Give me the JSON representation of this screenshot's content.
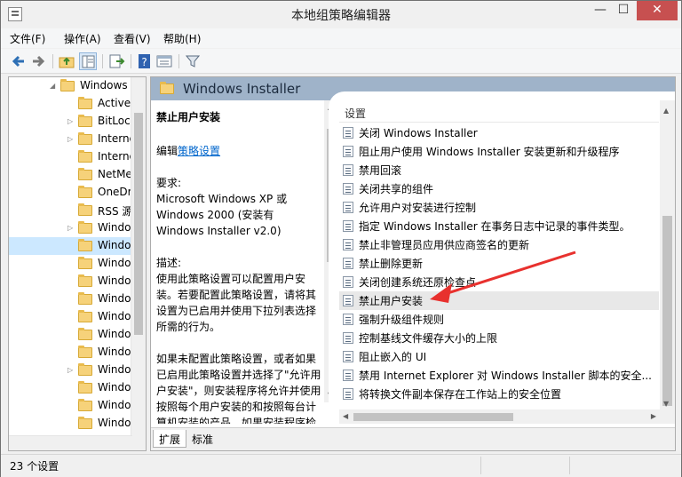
{
  "window": {
    "title": "本地组策略编辑器",
    "minimize_glyph": "—",
    "maximize_glyph": "☐",
    "close_glyph": "✕"
  },
  "menu": [
    "文件(F)",
    "操作(A)",
    "查看(V)",
    "帮助(H)"
  ],
  "toolbar": {
    "buttons": [
      "back-icon",
      "forward-icon",
      "up-folder-icon",
      "show-hide-tree-icon",
      "export-list-icon",
      "help-icon",
      "properties-icon",
      "filter-icon"
    ]
  },
  "tree": {
    "items": [
      {
        "label": "Windows",
        "expander": "◢"
      },
      {
        "label": "ActiveX",
        "expander": ""
      },
      {
        "label": "BitLock",
        "expander": "▷"
      },
      {
        "label": "Interne",
        "expander": "▷"
      },
      {
        "label": "Interne",
        "expander": ""
      },
      {
        "label": "NetMe",
        "expander": ""
      },
      {
        "label": "OneDr",
        "expander": ""
      },
      {
        "label": "RSS 源",
        "expander": ""
      },
      {
        "label": "Windo",
        "expander": "▷"
      },
      {
        "label": "Windo",
        "expander": "",
        "selected": true
      },
      {
        "label": "Windo",
        "expander": ""
      },
      {
        "label": "Windo",
        "expander": ""
      },
      {
        "label": "Windo",
        "expander": ""
      },
      {
        "label": "Windo",
        "expander": ""
      },
      {
        "label": "Windo",
        "expander": ""
      },
      {
        "label": "Windo",
        "expander": ""
      },
      {
        "label": "Windo",
        "expander": "▷"
      },
      {
        "label": "Windo",
        "expander": ""
      },
      {
        "label": "Windo",
        "expander": ""
      },
      {
        "label": "Windo",
        "expander": ""
      }
    ]
  },
  "header": {
    "title": "Windows Installer"
  },
  "description": {
    "title": "禁止用户安装",
    "edit_prefix": "编辑",
    "edit_link": "策略设置",
    "requirements_label": "要求:",
    "requirements": "Microsoft Windows XP 或 Windows 2000 (安装有 Windows Installer v2.0)",
    "description_label": "描述:",
    "description": "使用此策略设置可以配置用户安装。若要配置此策略设置，请将其设置为已启用并使用下拉列表选择所需的行为。",
    "extra": "如果未配置此策略设置，或者如果已启用此策略设置并选择了\"允许用户安装\"，则安装程序将允许并使用按照每个用户安装的和按照每台计算机安装的产品。如果安装程序检测到某个应用程序是按照每个用户安装的，它将隐藏该产品按照每台"
  },
  "settings": {
    "column_header": "设置",
    "items": [
      "关闭 Windows Installer",
      "阻止用户使用 Windows Installer 安装更新和升级程序",
      "禁用回滚",
      "关闭共享的组件",
      "允许用户对安装进行控制",
      "指定 Windows Installer 在事务日志中记录的事件类型。",
      "禁止非管理员应用供应商签名的更新",
      "禁止删除更新",
      "关闭创建系统还原检查点",
      "禁止用户安装",
      "强制升级组件规则",
      "控制基线文件缓存大小的上限",
      "阻止嵌入的 UI",
      "禁用 Internet Explorer 对 Windows Installer 脚本的安全...",
      "将转换文件副本保存在工作站上的安全位置"
    ],
    "selected_index": 9
  },
  "tabs": [
    "扩展",
    "标准"
  ],
  "status": {
    "text": "23 个设置"
  },
  "colors": {
    "annotation_arrow": "#e8312e",
    "header_band": "#9fb3c9",
    "selected_row": "#e8e8e8"
  }
}
